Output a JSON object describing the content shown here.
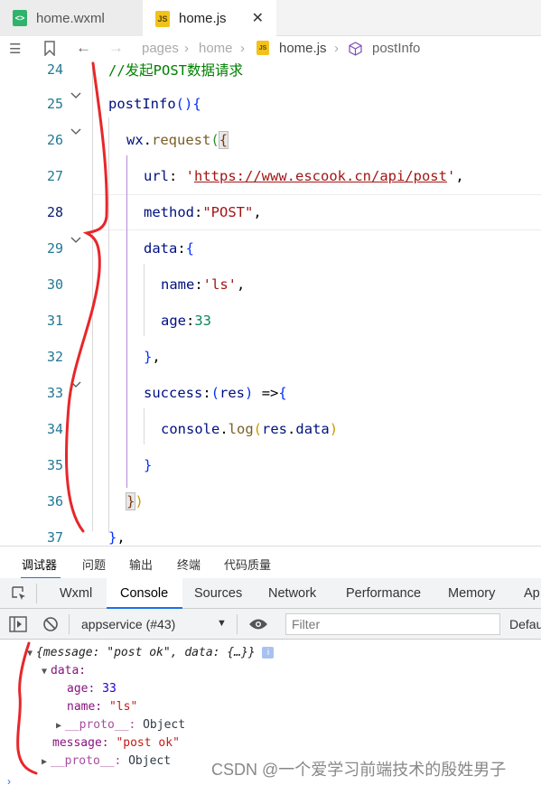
{
  "tabs": [
    {
      "label": "home.wxml",
      "icon": "wxml-file-icon",
      "active": false
    },
    {
      "label": "home.js",
      "icon": "js-file-icon",
      "active": true,
      "close": "✕"
    }
  ],
  "breadcrumb": {
    "items": [
      "pages",
      "home",
      "home.js",
      "postInfo"
    ]
  },
  "editor": {
    "line_numbers": [
      "24",
      "25",
      "26",
      "27",
      "28",
      "29",
      "30",
      "31",
      "32",
      "33",
      "34",
      "35",
      "36",
      "37"
    ],
    "active_line": "28",
    "lines": {
      "l24": "//发起POST数据请求",
      "l25_name": "postInfo",
      "l26_obj": "wx",
      "l26_fn": "request",
      "l27_key": "url",
      "l27_url": "https://www.escook.cn/api/post",
      "l28_key": "method",
      "l28_val": "\"POST\"",
      "l29_key": "data",
      "l30_key": "name",
      "l30_val": "'ls'",
      "l31_key": "age",
      "l31_val": "33",
      "l33_key": "success",
      "l33_param": "res",
      "l34_obj": "console",
      "l34_fn": "log",
      "l34_arg1": "res",
      "l34_arg2": "data"
    }
  },
  "panel": {
    "tabs": [
      "调试器",
      "问题",
      "输出",
      "终端",
      "代码质量"
    ],
    "selected": "调试器"
  },
  "devtools": {
    "tabs": [
      "Wxml",
      "Console",
      "Sources",
      "Network",
      "Performance",
      "Memory",
      "Ap"
    ],
    "selected": "Console"
  },
  "toolbar": {
    "context": "appservice (#43)",
    "filter_placeholder": "Filter",
    "levels": "Defau"
  },
  "console": {
    "summary": "{message: \"post ok\", data: {…}}",
    "data_label": "data:",
    "age_label": "age:",
    "age_value": "33",
    "name_label": "name:",
    "name_value": "\"ls\"",
    "proto_label": "__proto__:",
    "proto_value": "Object",
    "message_label": "message:",
    "message_value": "\"post ok\"",
    "info_badge": "i"
  },
  "watermark": "CSDN @一个爱学习前端技术的殷姓男子",
  "colors": {
    "accent": "#1a73e8",
    "annotation": "#e8262a",
    "comment": "#008000"
  }
}
